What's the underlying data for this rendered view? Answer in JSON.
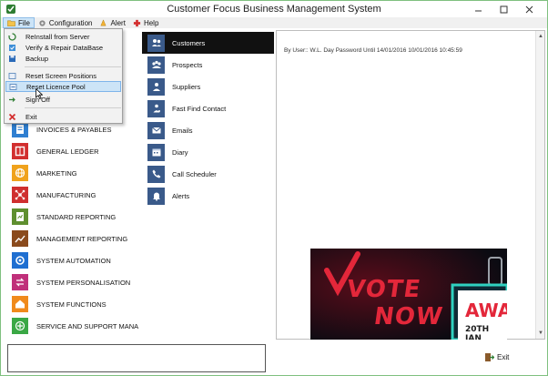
{
  "window": {
    "title": "Customer Focus Business Management System"
  },
  "menubar": {
    "items": [
      {
        "label": "File",
        "icon": "folder-icon"
      },
      {
        "label": "Configuration",
        "icon": "gear-icon"
      },
      {
        "label": "Alert",
        "icon": "bell-icon"
      },
      {
        "label": "Help",
        "icon": "help-cross-icon"
      }
    ]
  },
  "file_menu": {
    "items": [
      {
        "label": "ReInstall from Server",
        "icon": "reinstall-icon"
      },
      {
        "label": "Verify & Repair DataBase",
        "icon": "verify-icon"
      },
      {
        "label": "Backup",
        "icon": "backup-icon"
      },
      {
        "label": "Reset Screen Positions",
        "icon": "reset-screen-icon"
      },
      {
        "label": "Reset Licence Pool",
        "icon": "reset-licence-icon"
      },
      {
        "label": "Sign Off",
        "icon": "sign-off-icon"
      },
      {
        "label": "Exit",
        "icon": "exit-x-icon"
      }
    ]
  },
  "modules": {
    "items": [
      {
        "label": "INVOICES & PAYABLES",
        "color": "#2f7fd1"
      },
      {
        "label": "GENERAL LEDGER",
        "color": "#d22f2f"
      },
      {
        "label": "MARKETING",
        "color": "#f0a21c"
      },
      {
        "label": "MANUFACTURING",
        "color": "#cf2f2f"
      },
      {
        "label": "STANDARD REPORTING",
        "color": "#5f8f2f"
      },
      {
        "label": "MANAGEMENT REPORTING",
        "color": "#8a4a1c"
      },
      {
        "label": "SYSTEM AUTOMATION",
        "color": "#1f6fd1"
      },
      {
        "label": "SYSTEM PERSONALISATION",
        "color": "#c0307a"
      },
      {
        "label": "SYSTEM FUNCTIONS",
        "color": "#f08a1c"
      },
      {
        "label": "SERVICE AND SUPPORT MANAGE",
        "color": "#3aa845"
      }
    ]
  },
  "submodules": {
    "items": [
      {
        "label": "Customers"
      },
      {
        "label": "Prospects"
      },
      {
        "label": "Suppliers"
      },
      {
        "label": "Fast Find Contact"
      },
      {
        "label": "Emails"
      },
      {
        "label": "Diary"
      },
      {
        "label": "Call Scheduler"
      },
      {
        "label": "Alerts"
      }
    ]
  },
  "right_panel": {
    "info_text": "By User:: W.L. Day  Password Until  14/01/2016  10/01/2016  10:45:59"
  },
  "banner": {
    "line1": "VOTE",
    "line2": "NOW",
    "badge_title": "AWA",
    "badge_sub": "20TH JAN"
  },
  "footer": {
    "exit_label": "Exit"
  },
  "colors": {
    "accent_blue": "#3a5a8a",
    "menu_hover": "#cce4f7",
    "banner_red": "#e3273a",
    "banner_teal": "#2fd1c0"
  }
}
